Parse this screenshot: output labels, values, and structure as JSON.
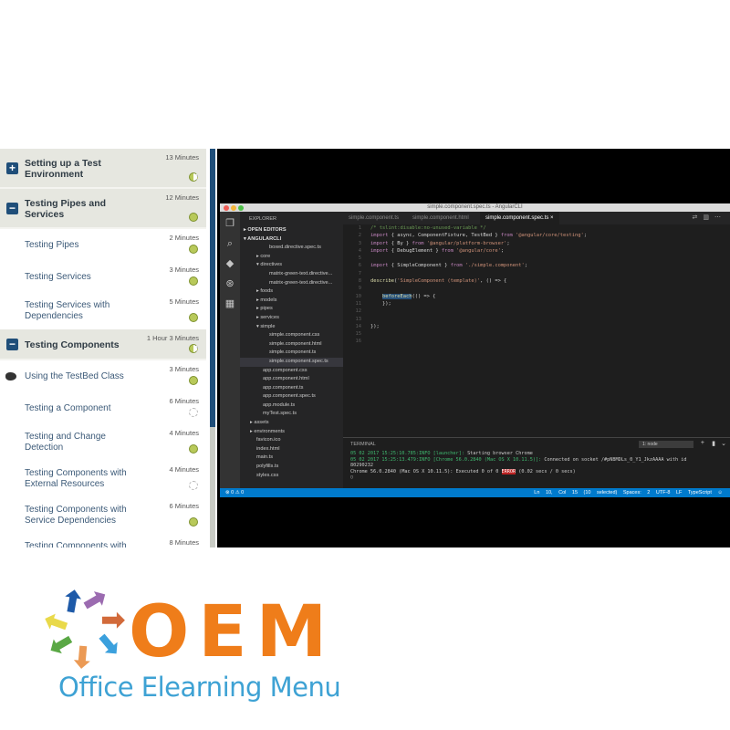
{
  "course": {
    "items": [
      {
        "type": "section",
        "state": "collapsed",
        "toggle_icon": "plus-icon",
        "title": "Setting up a Test Environment",
        "duration": "13 Minutes",
        "status": "partial"
      },
      {
        "type": "section",
        "state": "expanded",
        "toggle_icon": "minus-icon",
        "title": "Testing Pipes and Services",
        "duration": "12 Minutes",
        "status": "complete"
      },
      {
        "type": "lesson",
        "title": "Testing Pipes",
        "duration": "2 Minutes",
        "status": "complete"
      },
      {
        "type": "lesson",
        "title": "Testing Services",
        "duration": "3 Minutes",
        "status": "complete"
      },
      {
        "type": "lesson",
        "title": "Testing Services with Dependencies",
        "duration": "5 Minutes",
        "status": "complete"
      },
      {
        "type": "section",
        "state": "expanded",
        "toggle_icon": "minus-icon",
        "title": "Testing Components",
        "duration": "1 Hour 3 Minutes",
        "status": "partial"
      },
      {
        "type": "lesson",
        "title": "Using the TestBed Class",
        "duration": "3 Minutes",
        "status": "complete",
        "current": true
      },
      {
        "type": "lesson",
        "title": "Testing a Component",
        "duration": "6 Minutes",
        "status": "not-started"
      },
      {
        "type": "lesson",
        "title": "Testing and Change Detection",
        "duration": "4 Minutes",
        "status": "complete"
      },
      {
        "type": "lesson",
        "title": "Testing Components with External Resources",
        "duration": "4 Minutes",
        "status": "not-started"
      },
      {
        "type": "lesson",
        "title": "Testing Components with Service Dependencies",
        "duration": "6 Minutes",
        "status": "complete"
      },
      {
        "type": "lesson",
        "title": "Testing Components with Async Services",
        "duration": "8 Minutes",
        "status": "not-started"
      }
    ]
  },
  "video": {
    "window_title": "simple.component.spec.ts - AngularCLI",
    "explorer": {
      "header": "EXPLORER",
      "rows": [
        {
          "label": "OPEN EDITORS",
          "indent": 0,
          "arrow": "▸",
          "bold": true
        },
        {
          "label": "ANGULARCLI",
          "indent": 0,
          "arrow": "▾",
          "bold": true
        },
        {
          "label": "boxed.directive.spec.ts",
          "indent": 4,
          "arrow": ""
        },
        {
          "label": "core",
          "indent": 2,
          "arrow": "▸"
        },
        {
          "label": "directives",
          "indent": 2,
          "arrow": "▾"
        },
        {
          "label": "matrix-green-text.directive...",
          "indent": 4,
          "arrow": ""
        },
        {
          "label": "matrix-green-text.directive...",
          "indent": 4,
          "arrow": ""
        },
        {
          "label": "foods",
          "indent": 2,
          "arrow": "▸"
        },
        {
          "label": "models",
          "indent": 2,
          "arrow": "▸"
        },
        {
          "label": "pipes",
          "indent": 2,
          "arrow": "▸"
        },
        {
          "label": "services",
          "indent": 2,
          "arrow": "▸"
        },
        {
          "label": "simple",
          "indent": 2,
          "arrow": "▾"
        },
        {
          "label": "simple.component.css",
          "indent": 4,
          "arrow": ""
        },
        {
          "label": "simple.component.html",
          "indent": 4,
          "arrow": ""
        },
        {
          "label": "simple.component.ts",
          "indent": 4,
          "arrow": ""
        },
        {
          "label": "simple.component.spec.ts",
          "indent": 4,
          "arrow": "",
          "selected": true
        },
        {
          "label": "app.component.css",
          "indent": 3,
          "arrow": ""
        },
        {
          "label": "app.component.html",
          "indent": 3,
          "arrow": ""
        },
        {
          "label": "app.component.ts",
          "indent": 3,
          "arrow": ""
        },
        {
          "label": "app.component.spec.ts",
          "indent": 3,
          "arrow": ""
        },
        {
          "label": "app.module.ts",
          "indent": 3,
          "arrow": ""
        },
        {
          "label": "myTest.spec.ts",
          "indent": 3,
          "arrow": ""
        },
        {
          "label": "assets",
          "indent": 1,
          "arrow": "▸"
        },
        {
          "label": "environments",
          "indent": 1,
          "arrow": "▸"
        },
        {
          "label": "favicon.ico",
          "indent": 2,
          "arrow": ""
        },
        {
          "label": "index.html",
          "indent": 2,
          "arrow": ""
        },
        {
          "label": "main.ts",
          "indent": 2,
          "arrow": ""
        },
        {
          "label": "polyfills.ts",
          "indent": 2,
          "arrow": ""
        },
        {
          "label": "styles.css",
          "indent": 2,
          "arrow": ""
        }
      ]
    },
    "tabs": [
      {
        "label": "simple.component.ts",
        "active": false
      },
      {
        "label": "simple.component.html",
        "active": false
      },
      {
        "label": "simple.component.spec.ts",
        "active": true
      }
    ],
    "code_lines": [
      {
        "n": "1",
        "parts": [
          [
            "c-cm",
            "/* tslint:disable:no-unused-variable */"
          ]
        ]
      },
      {
        "n": "2",
        "parts": [
          [
            "c-kw",
            "import"
          ],
          [
            "c-tx",
            " { async, ComponentFixture, TestBed } "
          ],
          [
            "c-kw",
            "from"
          ],
          [
            "c-st",
            " '@angular/core/testing'"
          ],
          [
            "c-tx",
            ";"
          ]
        ]
      },
      {
        "n": "3",
        "parts": [
          [
            "c-kw",
            "import"
          ],
          [
            "c-tx",
            " { By } "
          ],
          [
            "c-kw",
            "from"
          ],
          [
            "c-st",
            " '@angular/platform-browser'"
          ],
          [
            "c-tx",
            ";"
          ]
        ]
      },
      {
        "n": "4",
        "parts": [
          [
            "c-kw",
            "import"
          ],
          [
            "c-tx",
            " { DebugElement } "
          ],
          [
            "c-kw",
            "from"
          ],
          [
            "c-st",
            " '@angular/core'"
          ],
          [
            "c-tx",
            ";"
          ]
        ]
      },
      {
        "n": "5",
        "parts": []
      },
      {
        "n": "6",
        "parts": [
          [
            "c-kw",
            "import"
          ],
          [
            "c-tx",
            " { SimpleComponent } "
          ],
          [
            "c-kw",
            "from"
          ],
          [
            "c-st",
            " './simple.component'"
          ],
          [
            "c-tx",
            ";"
          ]
        ]
      },
      {
        "n": "7",
        "parts": []
      },
      {
        "n": "8",
        "parts": [
          [
            "c-fn",
            "describe"
          ],
          [
            "c-tx",
            "("
          ],
          [
            "c-st",
            "'SimpleComponent (template)'"
          ],
          [
            "c-tx",
            ", () => {"
          ]
        ]
      },
      {
        "n": "9",
        "parts": []
      },
      {
        "n": "10",
        "parts": [
          [
            "c-tx",
            "    "
          ],
          [
            "c-fn hl",
            "beforeEach"
          ],
          [
            "c-tx",
            "(() => {"
          ]
        ]
      },
      {
        "n": "11",
        "parts": [
          [
            "c-tx",
            "    });"
          ]
        ]
      },
      {
        "n": "12",
        "parts": []
      },
      {
        "n": "13",
        "parts": []
      },
      {
        "n": "14",
        "parts": [
          [
            "c-tx",
            "});"
          ]
        ]
      },
      {
        "n": "15",
        "parts": []
      },
      {
        "n": "16",
        "parts": []
      }
    ],
    "terminal": {
      "header": "TERMINAL",
      "select_value": "1: node",
      "lines": [
        [
          [
            "t-green",
            "05 02 2017 15:25:10.785:INFO [launcher]: "
          ],
          [
            "",
            "Starting browser Chrome"
          ]
        ],
        [
          [
            "t-green",
            "05 02 2017 15:25:13.479:INFO [Chrome 56.0.2840 (Mac OS X 10.11.5)]: "
          ],
          [
            "",
            "Connected on socket /#pNBMDLs_0_Y1_JkzAAAA with id"
          ]
        ],
        [
          [
            "",
            "80290232"
          ]
        ],
        [
          [
            "",
            "Chrome 56.0.2840 (Mac OS X 10.11.5): Executed 0 of 0 "
          ],
          [
            "t-err",
            "ERROR"
          ],
          [
            "",
            " (0.02 secs / 0 secs)"
          ]
        ],
        [
          [
            "",
            "▯"
          ]
        ]
      ]
    },
    "status_bar": {
      "left": "⊗ 0  ⚠ 0",
      "position": "Ln 10, Col 15 (10 selected)",
      "spaces": "Spaces: 2",
      "encoding": "UTF-8",
      "eol": "LF",
      "language": "TypeScript"
    }
  },
  "brand": {
    "name": "OEM",
    "tagline": "Office Elearning Menu",
    "orange": "#ef7d1a",
    "blue": "#3ea2d4",
    "arrow_colors": [
      "#1e5aa8",
      "#9b6bb0",
      "#d26a3a",
      "#3ba0dd",
      "#eb9a55",
      "#5aa845",
      "#e9d94a"
    ]
  }
}
